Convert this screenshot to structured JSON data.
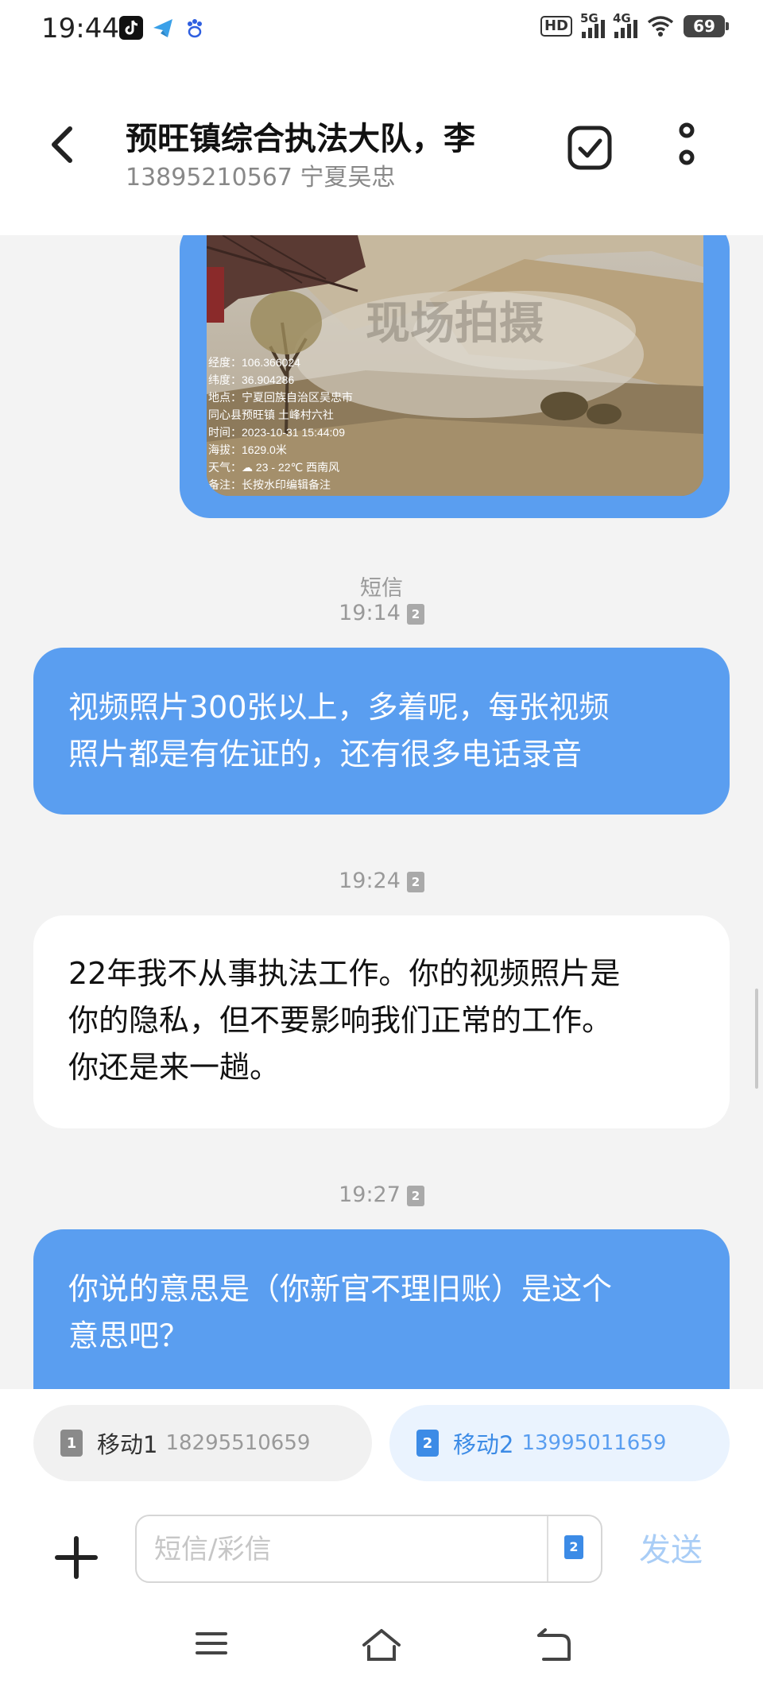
{
  "status_bar": {
    "time": "19:44",
    "hd_label": "HD",
    "sig1_label": "5G",
    "sig2_label": "4G",
    "battery": "69",
    "app_icons": [
      "tiktok-icon",
      "paper-plane-icon",
      "baidu-paw-icon"
    ]
  },
  "header": {
    "title": "预旺镇综合执法大队，李",
    "subtitle": "13895210567 宁夏吴忠"
  },
  "photo": {
    "watermark": "现场拍摄",
    "overlay_lines": [
      "经度：106.366024",
      "纬度：36.904286",
      "地点：宁夏回族自治区吴忠市",
      "同心县预旺镇 土峰村六社",
      "时间：2023-10-31 15:44:09",
      "海拔：1629.0米",
      "天气：☁ 23 - 22℃ 西南风",
      "备注：长按水印编辑备注"
    ]
  },
  "messages": [
    {
      "type": "timestamp",
      "label": "短信",
      "time": "19:14",
      "sim": "2"
    },
    {
      "type": "outgoing",
      "text_lines": [
        "视频照片300张以上，多着呢，每张视频",
        "照片都是有佐证的，还有很多电话录音"
      ]
    },
    {
      "type": "timestamp",
      "time": "19:24",
      "sim": "2"
    },
    {
      "type": "incoming",
      "text_lines": [
        "22年我不从事执法工作。你的视频照片是",
        "你的隐私，但不要影响我们正常的工作。",
        "你还是来一趟。"
      ]
    },
    {
      "type": "timestamp",
      "time": "19:27",
      "sim": "2"
    },
    {
      "type": "outgoing",
      "text_lines": [
        "你说的意思是（你新官不理旧账）是这个",
        "意思吧？"
      ]
    }
  ],
  "sim_selector": [
    {
      "slot": "1",
      "name": "移动1",
      "number": "18295510659",
      "selected": false
    },
    {
      "slot": "2",
      "name": "移动2",
      "number": "13995011659",
      "selected": true
    }
  ],
  "composer": {
    "placeholder": "短信/彩信",
    "sim_badge": "2",
    "send_label": "发送"
  },
  "colors": {
    "outgoing_bubble": "#5a9ef0",
    "incoming_bubble": "#ffffff",
    "background": "#f3f3f3",
    "accent": "#3c8be6",
    "send_disabled": "#a9cdf6"
  }
}
